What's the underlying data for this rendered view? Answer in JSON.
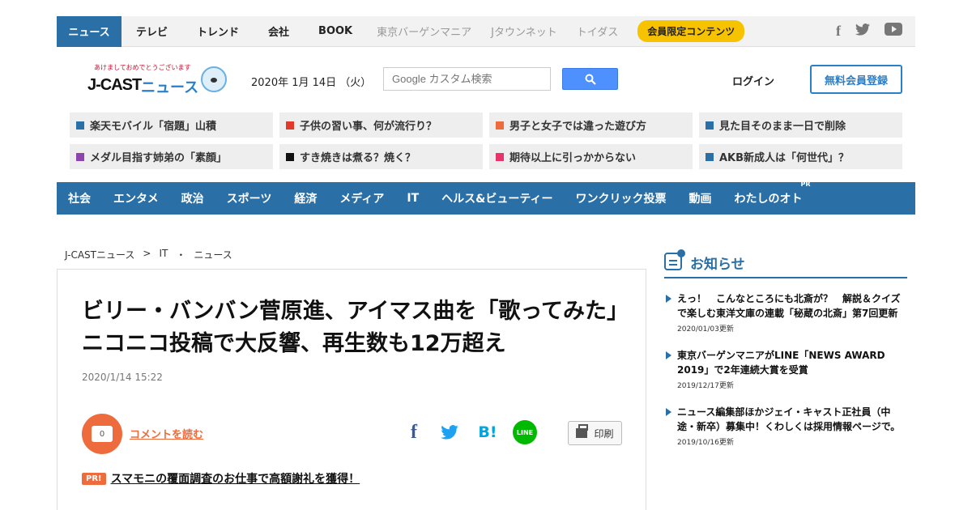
{
  "topbar": {
    "tabs": [
      "ニュース",
      "テレビ",
      "トレンド",
      "会社",
      "BOOK"
    ],
    "muted_tabs": [
      "東京バーゲンマニア",
      "Jタウンネット",
      "トイダス"
    ],
    "badge": "会員限定コンテンツ",
    "social_icons": [
      "facebook-icon",
      "twitter-icon",
      "youtube-icon"
    ]
  },
  "header": {
    "logo_greeting": "あけましておめでとうございます",
    "logo_text": "J-CAST",
    "logo_news": "ニュース",
    "date": "2020年 1月 14日 （火）",
    "search_placeholder": "Google カスタム検索",
    "login": "ログイン",
    "register": "無料会員登録"
  },
  "headline_links": [
    {
      "text": "楽天モバイル「宿題」山積",
      "color": "#2a6fa6"
    },
    {
      "text": "子供の習い事、何が流行り？",
      "color": "#e23a2a"
    },
    {
      "text": "男子と女子では違った遊び方",
      "color": "#ed6b3c"
    },
    {
      "text": "見た目そのまま一日で削除",
      "color": "#2a6fa6"
    },
    {
      "text": "メダル目指す姉弟の「素顔」",
      "color": "#8e44ad"
    },
    {
      "text": "すき焼きは煮る？焼く？",
      "color": "#111111"
    },
    {
      "text": "期待以上に引っかからない",
      "color": "#e8336b"
    },
    {
      "text": "AKB新成人は「何世代」？",
      "color": "#2a6fa6"
    }
  ],
  "categories": [
    "社会",
    "エンタメ",
    "政治",
    "スポーツ",
    "経済",
    "メディア",
    "IT",
    "ヘルス&ビューティー",
    "ワンクリック投票",
    "動画",
    "わたしのオト"
  ],
  "category_pr": "PR",
  "breadcrumb": [
    "J-CASTニュース",
    ">",
    "IT",
    "・",
    "ニュース"
  ],
  "article": {
    "title": "ビリー・バンバン菅原進、アイマス曲を「歌ってみた」　ニコニコ投稿で大反響、再生数も12万超え",
    "timestamp": "2020/1/14 15:22",
    "comment_count": "0",
    "comment_link": "コメントを読む",
    "share_fb": "f",
    "share_tw": "🐦",
    "share_hb": "B!",
    "share_line": "LINE",
    "print": "印刷",
    "pr_badge": "PR!",
    "pr_link": "スマモニの覆面調査のお仕事で高額謝礼を獲得！"
  },
  "sidebar": {
    "title": "お知らせ",
    "notices": [
      {
        "text": "えっ！　こんなところにも北斎が？　解説＆クイズで楽しむ東洋文庫の連載「秘蔵の北斎」第7回更新",
        "date": "2020/01/03更新"
      },
      {
        "text": "東京バーゲンマニアがLINE「NEWS AWARD 2019」で2年連続大賞を受賞",
        "date": "2019/12/17更新"
      },
      {
        "text": "ニュース編集部ほかジェイ・キャスト正社員（中途・新卒）募集中！くわしくは採用情報ページで。",
        "date": "2019/10/16更新"
      }
    ]
  },
  "colors": {
    "brand_blue": "#2a6fa6",
    "accent_orange": "#ed6b3c",
    "badge_yellow": "#f7c300"
  }
}
